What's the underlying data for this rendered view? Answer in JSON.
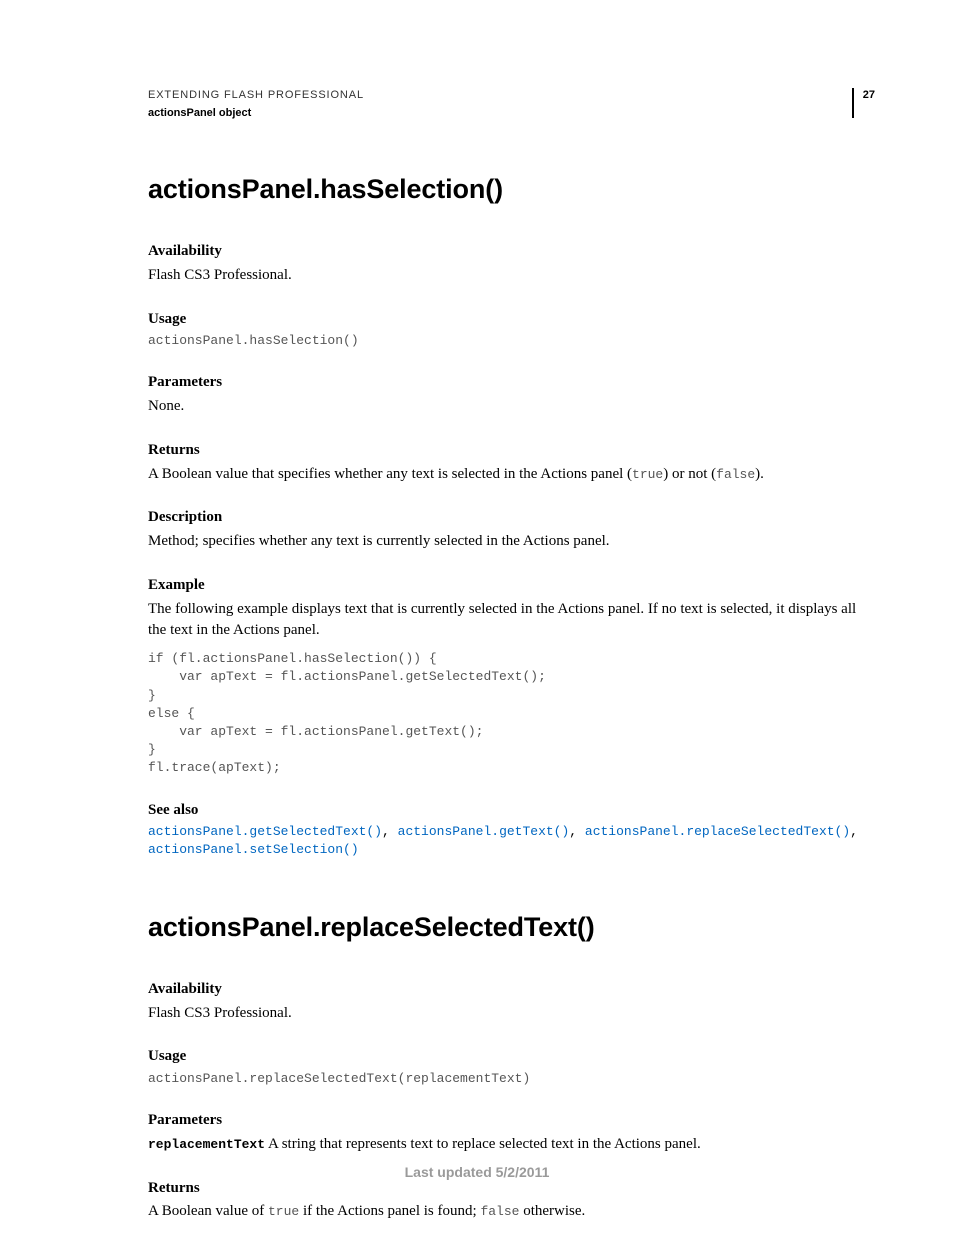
{
  "header": {
    "line1": "EXTENDING FLASH PROFESSIONAL",
    "line2": "actionsPanel object",
    "page_num": "27"
  },
  "topic1": {
    "title": "actionsPanel.hasSelection()",
    "availability_label": "Availability",
    "availability_text": "Flash CS3 Professional.",
    "usage_label": "Usage",
    "usage_code": "actionsPanel.hasSelection()",
    "parameters_label": "Parameters",
    "parameters_text": "None.",
    "returns_label": "Returns",
    "returns_pre": "A Boolean value that specifies whether any text is selected in the Actions panel (",
    "returns_true": "true",
    "returns_mid": ") or not (",
    "returns_false": "false",
    "returns_post": ").",
    "description_label": "Description",
    "description_text": "Method; specifies whether any text is currently selected in the Actions panel.",
    "example_label": "Example",
    "example_text": "The following example displays text that is currently selected in the Actions panel. If no text is selected, it displays all the text in the Actions panel.",
    "example_code": "if (fl.actionsPanel.hasSelection()) {\n    var apText = fl.actionsPanel.getSelectedText();\n}\nelse {\n    var apText = fl.actionsPanel.getText();\n}\nfl.trace(apText);",
    "seealso_label": "See also",
    "seealso": {
      "l1": "actionsPanel.getSelectedText()",
      "l2": "actionsPanel.getText()",
      "l3": "actionsPanel.replaceSelectedText()",
      "l4": "actionsPanel.setSelection()"
    }
  },
  "topic2": {
    "title": "actionsPanel.replaceSelectedText()",
    "availability_label": "Availability",
    "availability_text": "Flash CS3 Professional.",
    "usage_label": "Usage",
    "usage_code": "actionsPanel.replaceSelectedText(replacementText)",
    "parameters_label": "Parameters",
    "param_name": "replacementText",
    "param_desc": "  A string that represents text to replace selected text in the Actions panel.",
    "returns_label": "Returns",
    "returns_pre": "A Boolean value of ",
    "returns_true": "true",
    "returns_mid": " if the Actions panel is found; ",
    "returns_false": "false",
    "returns_post": " otherwise."
  },
  "footer": "Last updated 5/2/2011"
}
